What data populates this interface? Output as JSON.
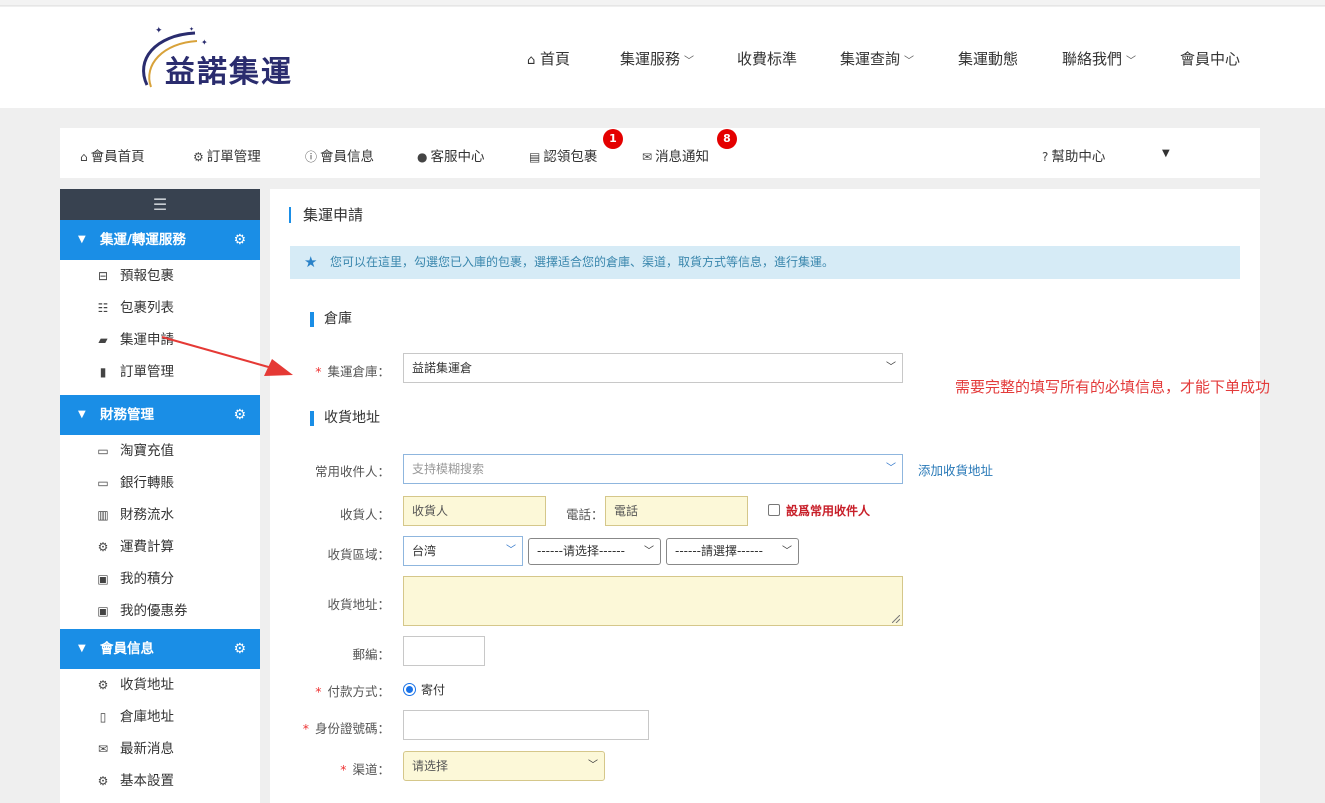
{
  "header": {
    "logo_text": "益諾集運",
    "nav": [
      {
        "label": "首頁",
        "icon": "home-icon",
        "has_caret": false
      },
      {
        "label": "集運服務",
        "has_caret": true
      },
      {
        "label": "收費标準",
        "has_caret": false
      },
      {
        "label": "集運查詢",
        "has_caret": true
      },
      {
        "label": "集運動態",
        "has_caret": false
      },
      {
        "label": "聯絡我們",
        "has_caret": true
      },
      {
        "label": "會員中心",
        "has_caret": false
      }
    ]
  },
  "member_nav": {
    "items": [
      {
        "label": "會員首頁",
        "icon": "home-icon"
      },
      {
        "label": "訂單管理",
        "icon": "gear-icon"
      },
      {
        "label": "會員信息",
        "icon": "info-icon"
      },
      {
        "label": "客服中心",
        "icon": "user-icon"
      },
      {
        "label": "認領包裹",
        "icon": "archive-icon",
        "badge": "1"
      },
      {
        "label": "消息通知",
        "icon": "envelope-icon",
        "badge": "8"
      }
    ],
    "help": {
      "label": "幫助中心",
      "icon": "question-icon"
    }
  },
  "sidebar": {
    "toggle_icon": "menu-icon",
    "groups": [
      {
        "title": "集運/轉運服務",
        "items": [
          {
            "label": "預報包裹",
            "icon": "inbox-icon"
          },
          {
            "label": "包裹列表",
            "icon": "list-icon"
          },
          {
            "label": "集運申請",
            "icon": "truck-icon"
          },
          {
            "label": "訂單管理",
            "icon": "book-icon"
          }
        ]
      },
      {
        "title": "財務管理",
        "items": [
          {
            "label": "淘寶充值",
            "icon": "credit-card-icon"
          },
          {
            "label": "銀行轉賬",
            "icon": "credit-card-icon"
          },
          {
            "label": "財務流水",
            "icon": "bar-chart-icon"
          },
          {
            "label": "運費計算",
            "icon": "gears-icon"
          },
          {
            "label": "我的積分",
            "icon": "gift-icon"
          },
          {
            "label": "我的優惠券",
            "icon": "gift-icon"
          }
        ]
      },
      {
        "title": "會員信息",
        "items": [
          {
            "label": "收貨地址",
            "icon": "gears-icon"
          },
          {
            "label": "倉庫地址",
            "icon": "building-icon"
          },
          {
            "label": "最新消息",
            "icon": "envelope-icon"
          },
          {
            "label": "基本設置",
            "icon": "gear-icon"
          }
        ]
      }
    ]
  },
  "main": {
    "title": "集運申請",
    "alert": "您可以在這里，勾選您已入庫的包裹，選擇适合您的倉庫、渠道，取貨方式等信息，進行集運。",
    "warehouse_section": "倉庫",
    "warehouse_label": "集運倉庫：",
    "warehouse_value": "益諾集運倉",
    "address_section": "收貨地址",
    "recipient_label": "常用收件人：",
    "recipient_placeholder": "支持模糊搜索",
    "add_address_link": "添加收貨地址",
    "consignee_label": "收貨人：",
    "consignee_placeholder": "收貨人",
    "phone_label": "電話：",
    "phone_placeholder": "電話",
    "set_default_label": "設爲常用收件人",
    "region_label": "收貨區域：",
    "region_value": "台湾",
    "region_select2": "------请选择------",
    "region_select3": "------請選擇------",
    "address_label": "收貨地址：",
    "postcode_label": "郵編：",
    "payment_label": "付款方式：",
    "payment_option": "寄付",
    "id_label": "身份證號碼：",
    "channel_label": "渠道：",
    "channel_value": "请选择"
  },
  "annotation": "需要完整的填写所有的必填信息，才能下单成功",
  "colors": {
    "accent": "#1a8ee6",
    "required": "#e33333",
    "annotation": "#e33a3a"
  }
}
